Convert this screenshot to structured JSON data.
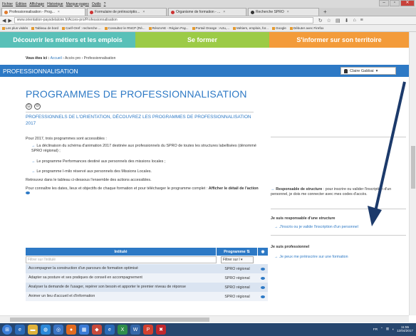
{
  "menubar": {
    "items": [
      "Fichier",
      "Édition",
      "Affichage",
      "Historique",
      "Marque-pages",
      "Outils",
      "?"
    ]
  },
  "tabs": [
    {
      "label": "Professionnalisation - Prog...",
      "active": true
    },
    {
      "label": "Formulaire de préinscriptio...",
      "active": false
    },
    {
      "label": "Organisme de formation - ...",
      "active": false
    },
    {
      "label": "Recherche SPRO",
      "active": false
    }
  ],
  "url": "www.orientation-paysdelaloire.fr/Acces-pro/Professionnalisation",
  "bookmarks": [
    "Les plus visités",
    "Tableau de bord",
    "Carif-Oref : recherche ...",
    "Consultez le RNCP (Ré...",
    "RésoVAE - Région Pay...",
    "Portail Orange : Actu,...",
    "Métiers, emplois, for...",
    "Google",
    "Débuter avec Firefox"
  ],
  "topnav": {
    "n1": "Découvrir les métiers et les emplois",
    "n2": "Se former",
    "n3": "S'informer sur son territoire"
  },
  "breadcrumb": {
    "prefix": "Vous êtes ici : ",
    "home": "Accueil",
    "sep1": " › Accès pro › ",
    "current": "Professionnalisation"
  },
  "bluebar": {
    "title": "PROFESSIONNALISATION",
    "user": "Claire Gabbai"
  },
  "main": {
    "title": "PROGRAMMES DE PROFESSIONNALISATION",
    "subtitle": "PROFESSIONNELS DE L'ORIENTATION, DÉCOUVREZ LES PROGRAMMES DE PROFESSIONNALISATION 2017",
    "intro": "Pour 2017, trois programmes sont accessibles :",
    "b1": "La déclinaison du schéma d'animation 2017 destinée aux professionnels du SPRO de toutes les structures labellisées (dénommé SPRO régional) ;",
    "b2": "Le programme Performances destiné aux personnels des missions locales ;",
    "b3": "Le programme I-milo réservé aux personnels des Missions Locales.",
    "retrouvez": "Retrouvez dans le tableau ci-dessous l'ensemble des actions accessibles.",
    "connaitre": "Pour connaître les dates, lieux et objectifs de chaque formation et pour télécharger le programme complet : ",
    "connaitre_bold": "Afficher le détail de l'action"
  },
  "table": {
    "h1": "Intitulé",
    "h2": "Programme",
    "filter_placeholder": "Filtrer sur l'intitulé",
    "filter_select": "Filtrer sur l",
    "rows": [
      {
        "title": "Accompagner la construction d'un parcours de formation optimisé",
        "prog": "SPRO régional"
      },
      {
        "title": "Adapter sa posture et ses pratiques de conseil en accompagnement",
        "prog": "SPRO régional"
      },
      {
        "title": "Analyser la demande de l'usager, repérer son besoin et apporter le premier niveau de réponse",
        "prog": "SPRO régional"
      },
      {
        "title": "Animer un lieu d'accueil et d'information",
        "prog": "SPRO régional"
      }
    ]
  },
  "sidebar": {
    "resp_bold": "Responsable de structure",
    "resp_text": " : pour inscrire ou valider l'inscription d'un personnel, je dois me connecter avec mes codes d'accès.",
    "h_resp": "Je suis responsable d'une structure",
    "l_resp": "J'inscris ou je valide l'inscription d'un personnel",
    "h_pro": "Je suis professionnel",
    "l_pro": "Je peux me préinscrire sur une formation"
  },
  "taskbar": {
    "lang": "FR",
    "time": "11:55",
    "date": "12/04/2017"
  },
  "colors": {
    "blue": "#2d79c5",
    "teal": "#59c0b8",
    "green": "#9ccb46",
    "orange": "#f39b3a",
    "navy_arrow": "#1c3a6b"
  }
}
